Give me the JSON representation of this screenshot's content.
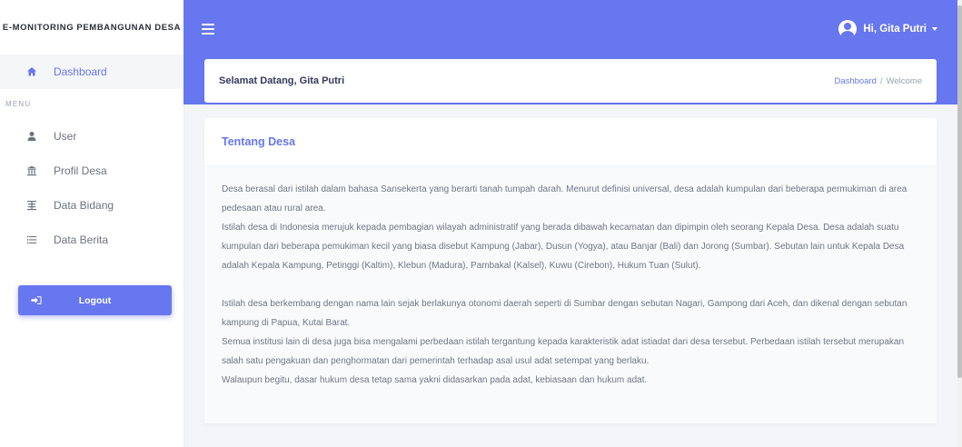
{
  "sidebar": {
    "brand": "E-MONITORING PEMBANGUNAN DESA",
    "dashboard_label": "Dashboard",
    "menu_header": "MENU",
    "items": [
      {
        "label": "User",
        "icon": "user-icon"
      },
      {
        "label": "Profil Desa",
        "icon": "building-icon"
      },
      {
        "label": "Data Bidang",
        "icon": "balance-icon"
      },
      {
        "label": "Data Berita",
        "icon": "list-icon"
      }
    ],
    "logout_label": "Logout"
  },
  "topbar": {
    "user_greeting": "Hi, Gita Putri"
  },
  "header": {
    "title": "Selamat Datang, Gita Putri",
    "breadcrumb": [
      "Dashboard",
      "Welcome"
    ],
    "breadcrumb_separator": "/"
  },
  "content": {
    "title": "Tentang Desa",
    "paragraphs": [
      "Desa berasal dari istilah dalam bahasa Sansekerta yang berarti tanah tumpah darah. Menurut definisi universal, desa adalah kumpulan dari beberapa permukiman di area pedesaan atau rural area.",
      "Istilah desa di Indonesia merujuk kepada pembagian wilayah administratif yang berada dibawah kecamatan dan dipimpin oleh seorang Kepala Desa. Desa adalah suatu kumpulan dari beberapa pemukiman kecil yang biasa disebut Kampung (Jabar), Dusun (Yogya), atau Banjar (Bali) dan Jorong (Sumbar). Sebutan lain untuk Kepala Desa adalah Kepala Kampung, Petinggi (Kaltim), Klebun (Madura), Pambakal (Kalsel), Kuwu (Cirebon), Hukum Tuan (Sulut).",
      "Istilah desa berkembang dengan nama lain sejak berlakunya otonomi daerah seperti di Sumbar dengan sebutan Nagari, Gampong dari Aceh, dan dikenal dengan sebutan kampung di Papua, Kutai Barat.",
      "Semua institusi lain di desa juga bisa mengalami perbedaan istilah tergantung kepada karakteristik adat istiadat dari desa tersebut. Perbedaan istilah tersebut merupakan salah satu pengakuan dan penghormatan dari pemerintah terhadap asal usul adat setempat yang berlaku.",
      "Walaupun begitu, dasar hukum desa tetap sama yakni didasarkan pada adat, kebiasaan dan hukum adat."
    ]
  },
  "colors": {
    "primary": "#6777ef",
    "background": "#f4f5f8",
    "text": "#6e7687"
  }
}
